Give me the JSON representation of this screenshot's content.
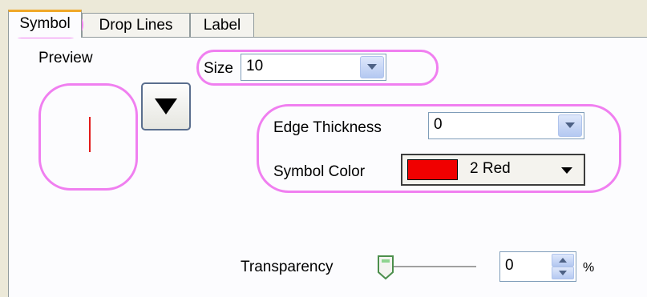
{
  "tabs": [
    {
      "label": "Symbol",
      "active": true
    },
    {
      "label": "Drop Lines",
      "active": false
    },
    {
      "label": "Label",
      "active": false
    }
  ],
  "preview": {
    "label": "Preview",
    "symbol_color": "#e21b1b"
  },
  "shape_button": {
    "icon": "down-triangle-icon"
  },
  "size": {
    "label": "Size",
    "value": "10"
  },
  "edge_thickness": {
    "label": "Edge Thickness",
    "value": "0"
  },
  "symbol_color": {
    "label": "Symbol Color",
    "value": "2 Red",
    "swatch": "#f00000"
  },
  "transparency": {
    "label": "Transparency",
    "value": "0",
    "unit": "%",
    "slider_level": 0
  },
  "highlight_color": "#f07ff0"
}
